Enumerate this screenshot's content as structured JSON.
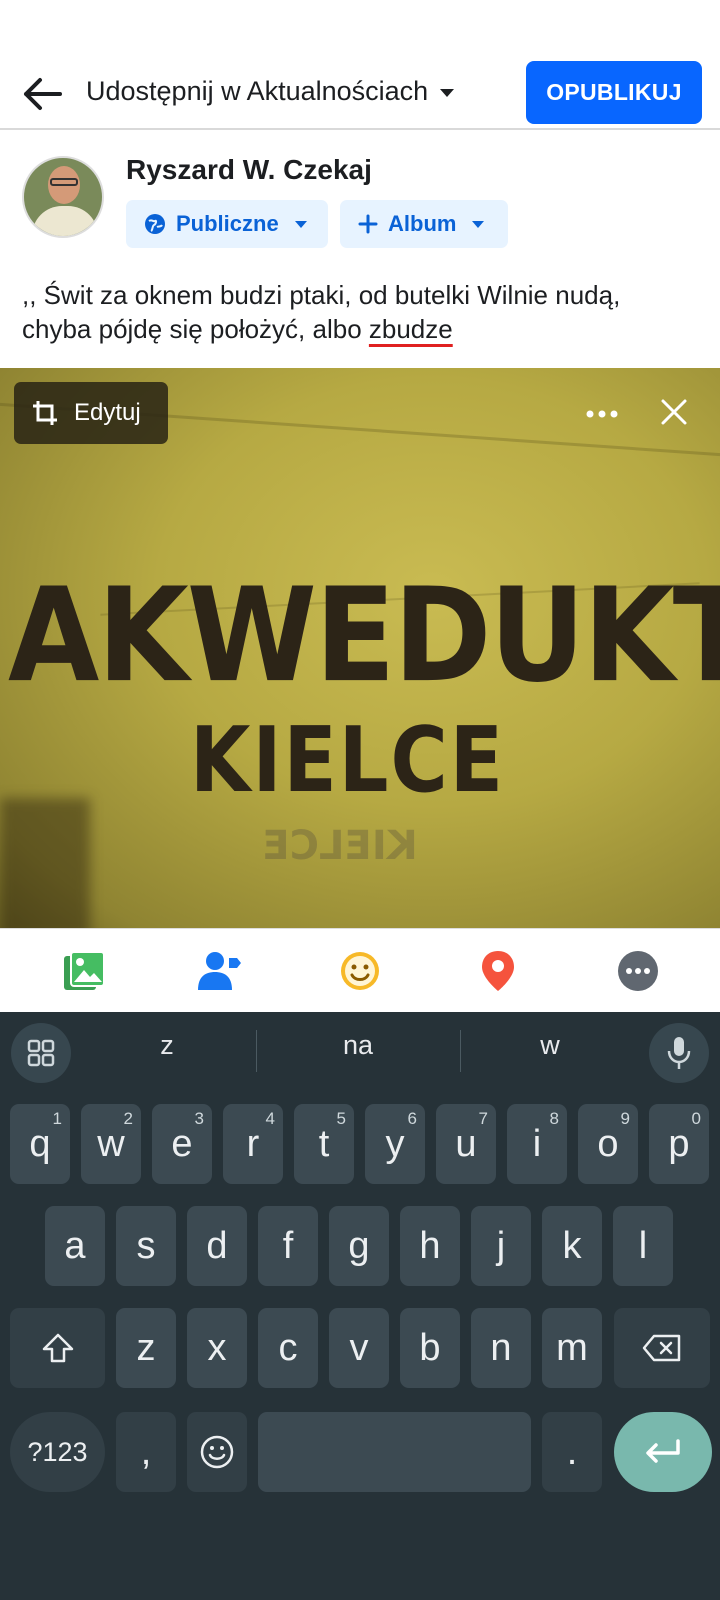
{
  "header": {
    "title": "Udostępnij w Aktualnościach",
    "publish_label": "OPUBLIKUJ",
    "accent_color": "#0866ff"
  },
  "author": {
    "name": "Ryszard W. Czekaj",
    "privacy_label": "Publiczne",
    "album_label": "Album"
  },
  "post": {
    "text_line1": ",, Świt za oknem budzi ptaki, od butelki Wilnie nudą,",
    "text_line2_plain": "chyba pójdę się położyć, albo ",
    "text_line2_misspelled": "zbudze"
  },
  "photo": {
    "edit_label": "Edytuj",
    "print_big": "AKWEDUKT",
    "print_small": "KIELCE",
    "print_ghost": "KIELCE"
  },
  "composer_tools": [
    {
      "icon": "photo-icon",
      "color": "#45bd62"
    },
    {
      "icon": "tag-people-icon",
      "color": "#1877f2"
    },
    {
      "icon": "feeling-icon",
      "color": "#f7b928"
    },
    {
      "icon": "location-pin-icon",
      "color": "#f5533d"
    },
    {
      "icon": "more-options-icon",
      "color": "#606770"
    }
  ],
  "keyboard": {
    "suggestions": [
      "z",
      "na",
      "w"
    ],
    "row1": [
      {
        "key": "q",
        "hint": "1"
      },
      {
        "key": "w",
        "hint": "2"
      },
      {
        "key": "e",
        "hint": "3"
      },
      {
        "key": "r",
        "hint": "4"
      },
      {
        "key": "t",
        "hint": "5"
      },
      {
        "key": "y",
        "hint": "6"
      },
      {
        "key": "u",
        "hint": "7"
      },
      {
        "key": "i",
        "hint": "8"
      },
      {
        "key": "o",
        "hint": "9"
      },
      {
        "key": "p",
        "hint": "0"
      }
    ],
    "row2": [
      "a",
      "s",
      "d",
      "f",
      "g",
      "h",
      "j",
      "k",
      "l"
    ],
    "row3": [
      "z",
      "x",
      "c",
      "v",
      "b",
      "n",
      "m"
    ],
    "symbols_label": "?123",
    "comma_label": ",",
    "period_label": "."
  }
}
